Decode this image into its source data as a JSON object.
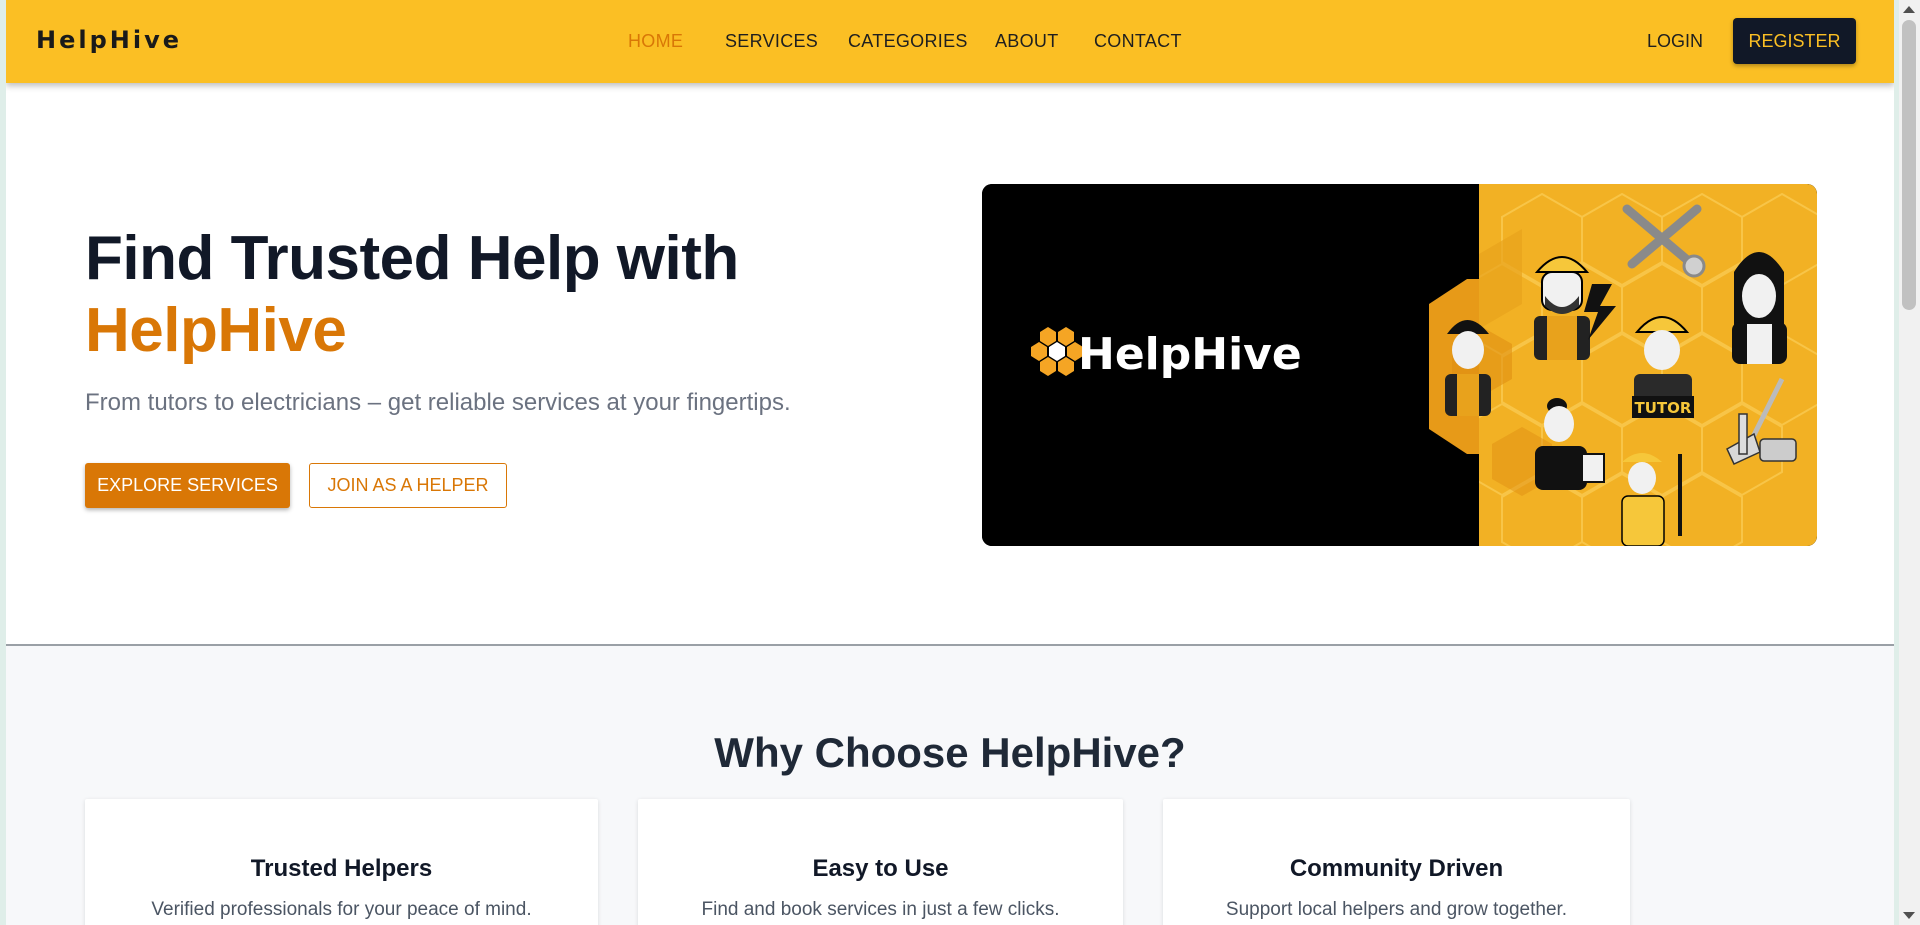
{
  "navbar": {
    "brand": "HelpHive",
    "links": [
      {
        "label": "HOME",
        "active": true
      },
      {
        "label": "SERVICES",
        "active": false
      },
      {
        "label": "CATEGORIES",
        "active": false
      },
      {
        "label": "ABOUT",
        "active": false
      },
      {
        "label": "CONTACT",
        "active": false
      }
    ],
    "login_label": "LOGIN",
    "register_label": "REGISTER"
  },
  "hero": {
    "title_line1": "Find Trusted Help with",
    "title_line2": "HelpHive",
    "subtitle": "From tutors to electricians – get reliable services at your fingertips.",
    "primary_cta": "EXPLORE SERVICES",
    "secondary_cta": "JOIN AS A HELPER",
    "image": {
      "logo_text": "HelpHive",
      "badge_text": "TUTOR",
      "icons": [
        "honeycomb-logo-icon",
        "wrench-icon",
        "electrician-icon",
        "support-agent-icon",
        "tutor-icon",
        "office-worker-icon",
        "cleaner-icon",
        "broom-icon"
      ]
    }
  },
  "why": {
    "title": "Why Choose HelpHive?",
    "cards": [
      {
        "title": "Trusted Helpers",
        "text": "Verified professionals for your peace of mind."
      },
      {
        "title": "Easy to Use",
        "text": "Find and book services in just a few clicks."
      },
      {
        "title": "Community Driven",
        "text": "Support local helpers and grow together."
      }
    ]
  },
  "colors": {
    "brand_yellow": "#fbbf24",
    "accent_orange": "#d97706",
    "dark": "#111827"
  }
}
